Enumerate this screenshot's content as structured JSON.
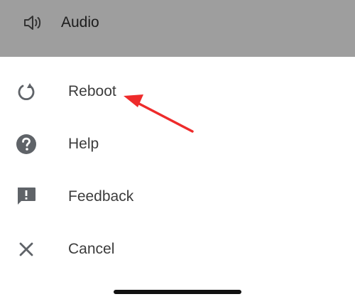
{
  "top": {
    "audio_label": "Audio",
    "audio_icon": "speaker-icon"
  },
  "menu": {
    "items": [
      {
        "label": "Reboot",
        "icon": "refresh-icon"
      },
      {
        "label": "Help",
        "icon": "help-icon"
      },
      {
        "label": "Feedback",
        "icon": "feedback-icon"
      },
      {
        "label": "Cancel",
        "icon": "close-icon"
      }
    ]
  },
  "colors": {
    "top_bar": "#9e9e9e",
    "icon": "#5f6368",
    "arrow": "#ee2b2b",
    "text": "#3c3c3c"
  }
}
